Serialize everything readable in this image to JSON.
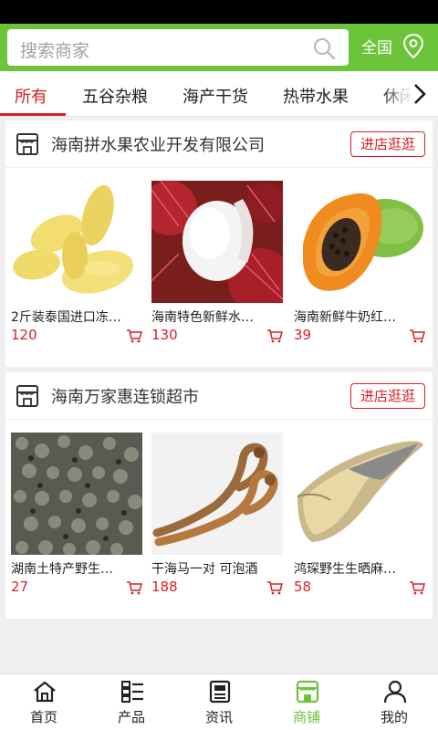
{
  "search": {
    "placeholder": "搜索商家",
    "region_label": "全国"
  },
  "categories": [
    {
      "label": "所有",
      "active": true
    },
    {
      "label": "五谷杂粮"
    },
    {
      "label": "海产干货"
    },
    {
      "label": "热带水果"
    },
    {
      "label": "休闲"
    }
  ],
  "shops": [
    {
      "name": "海南拼水果农业开发有限公司",
      "visit_label": "进店逛逛",
      "products": [
        {
          "title": "2斤装泰国进口冻…",
          "price": "120",
          "image": "durian-flesh"
        },
        {
          "title": "海南特色新鲜水…",
          "price": "130",
          "image": "rambutan"
        },
        {
          "title": "海南新鲜牛奶红…",
          "price": "39",
          "image": "papaya"
        }
      ]
    },
    {
      "name": "海南万家惠连锁超市",
      "visit_label": "进店逛逛",
      "products": [
        {
          "title": "湖南土特产野生…",
          "price": "27",
          "image": "dried-seeds"
        },
        {
          "title": "干海马一对 可泡酒",
          "price": "188",
          "image": "dried-seahorse"
        },
        {
          "title": "鸿琛野生生晒麻…",
          "price": "58",
          "image": "dried-fish"
        }
      ]
    }
  ],
  "tabbar": [
    {
      "label": "首页",
      "icon": "home-icon"
    },
    {
      "label": "产品",
      "icon": "list-icon"
    },
    {
      "label": "资讯",
      "icon": "news-icon"
    },
    {
      "label": "商铺",
      "icon": "shop-icon",
      "active": true
    },
    {
      "label": "我的",
      "icon": "user-icon"
    }
  ],
  "colors": {
    "brand_green": "#6bc43a",
    "accent_red": "#d81e23"
  }
}
